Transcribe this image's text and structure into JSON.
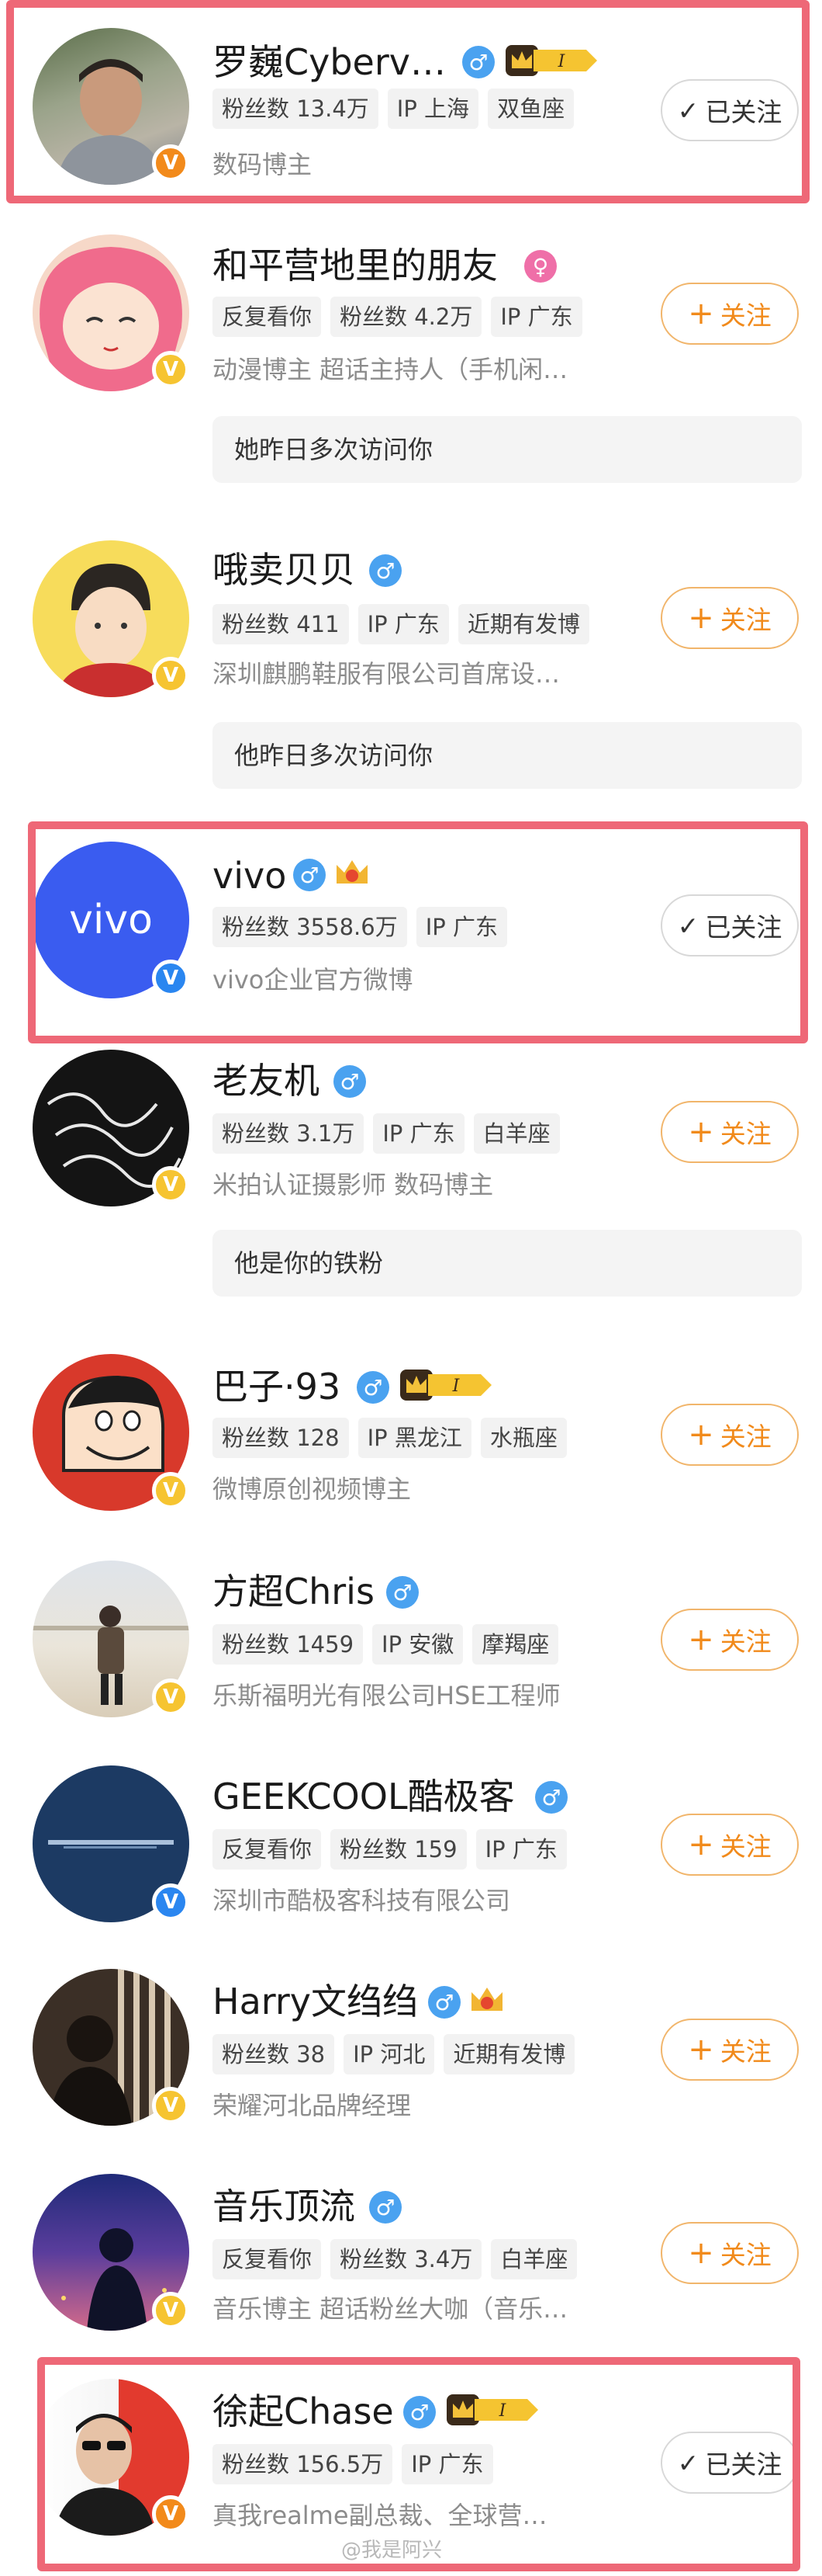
{
  "colors": {
    "follow_orange": "#f18a1b",
    "highlight_red": "#ee6877",
    "male_blue": "#4aa2f0",
    "female_pink": "#ef6fa8",
    "verify_yellow": "#f6c431",
    "verify_blue": "#2a86f0",
    "verify_orange": "#f28a1b"
  },
  "users": [
    {
      "name": "罗巍Cyberv…",
      "tags": [
        "粉丝数 13.4万",
        "IP 上海",
        "双鱼座"
      ],
      "desc": "数码博主",
      "button": "已关注",
      "visit": ""
    },
    {
      "name": "和平营地里的朋友",
      "tags": [
        "反复看你",
        "粉丝数 4.2万",
        "IP 广东"
      ],
      "desc": "动漫博主 超话主持人（手机闲…",
      "button": "关注",
      "visit": "她昨日多次访问你"
    },
    {
      "name": "哦卖贝贝",
      "tags": [
        "粉丝数 411",
        "IP 广东",
        "近期有发博"
      ],
      "desc": "深圳麒鹏鞋服有限公司首席设…",
      "button": "关注",
      "visit": "他昨日多次访问你"
    },
    {
      "name": "vivo",
      "tags": [
        "粉丝数 3558.6万",
        "IP 广东"
      ],
      "desc": "vivo企业官方微博",
      "button": "已关注",
      "visit": ""
    },
    {
      "name": "老友机",
      "tags": [
        "粉丝数 3.1万",
        "IP 广东",
        "白羊座"
      ],
      "desc": "米拍认证摄影师 数码博主",
      "button": "关注",
      "visit": "他是你的铁粉"
    },
    {
      "name": "巴子·93",
      "tags": [
        "粉丝数 128",
        "IP 黑龙江",
        "水瓶座"
      ],
      "desc": "微博原创视频博主",
      "button": "关注",
      "visit": ""
    },
    {
      "name": "方超Chris",
      "tags": [
        "粉丝数 1459",
        "IP 安徽",
        "摩羯座"
      ],
      "desc": "乐斯福明光有限公司HSE工程师",
      "button": "关注",
      "visit": ""
    },
    {
      "name": "GEEKCOOL酷极客",
      "tags": [
        "反复看你",
        "粉丝数 159",
        "IP 广东"
      ],
      "desc": "深圳市酷极客科技有限公司",
      "button": "关注",
      "visit": ""
    },
    {
      "name": "Harry文绉绉",
      "tags": [
        "粉丝数 38",
        "IP 河北",
        "近期有发博"
      ],
      "desc": "荣耀河北品牌经理",
      "button": "关注",
      "visit": ""
    },
    {
      "name": "音乐顶流",
      "tags": [
        "反复看你",
        "粉丝数 3.4万",
        "白羊座"
      ],
      "desc": "音乐博主 超话粉丝大咖（音乐…",
      "button": "关注",
      "visit": ""
    },
    {
      "name": "徐起Chase",
      "tags": [
        "粉丝数 156.5万",
        "IP 广东"
      ],
      "desc": "真我realme副总裁、全球营…",
      "button": "已关注",
      "visit": ""
    }
  ],
  "crown_label": "I",
  "badge_v": "V",
  "gender_male": "♂",
  "gender_female": "♀",
  "plus_sign": "+",
  "check_sign": "✓",
  "watermark": "@我是阿兴"
}
